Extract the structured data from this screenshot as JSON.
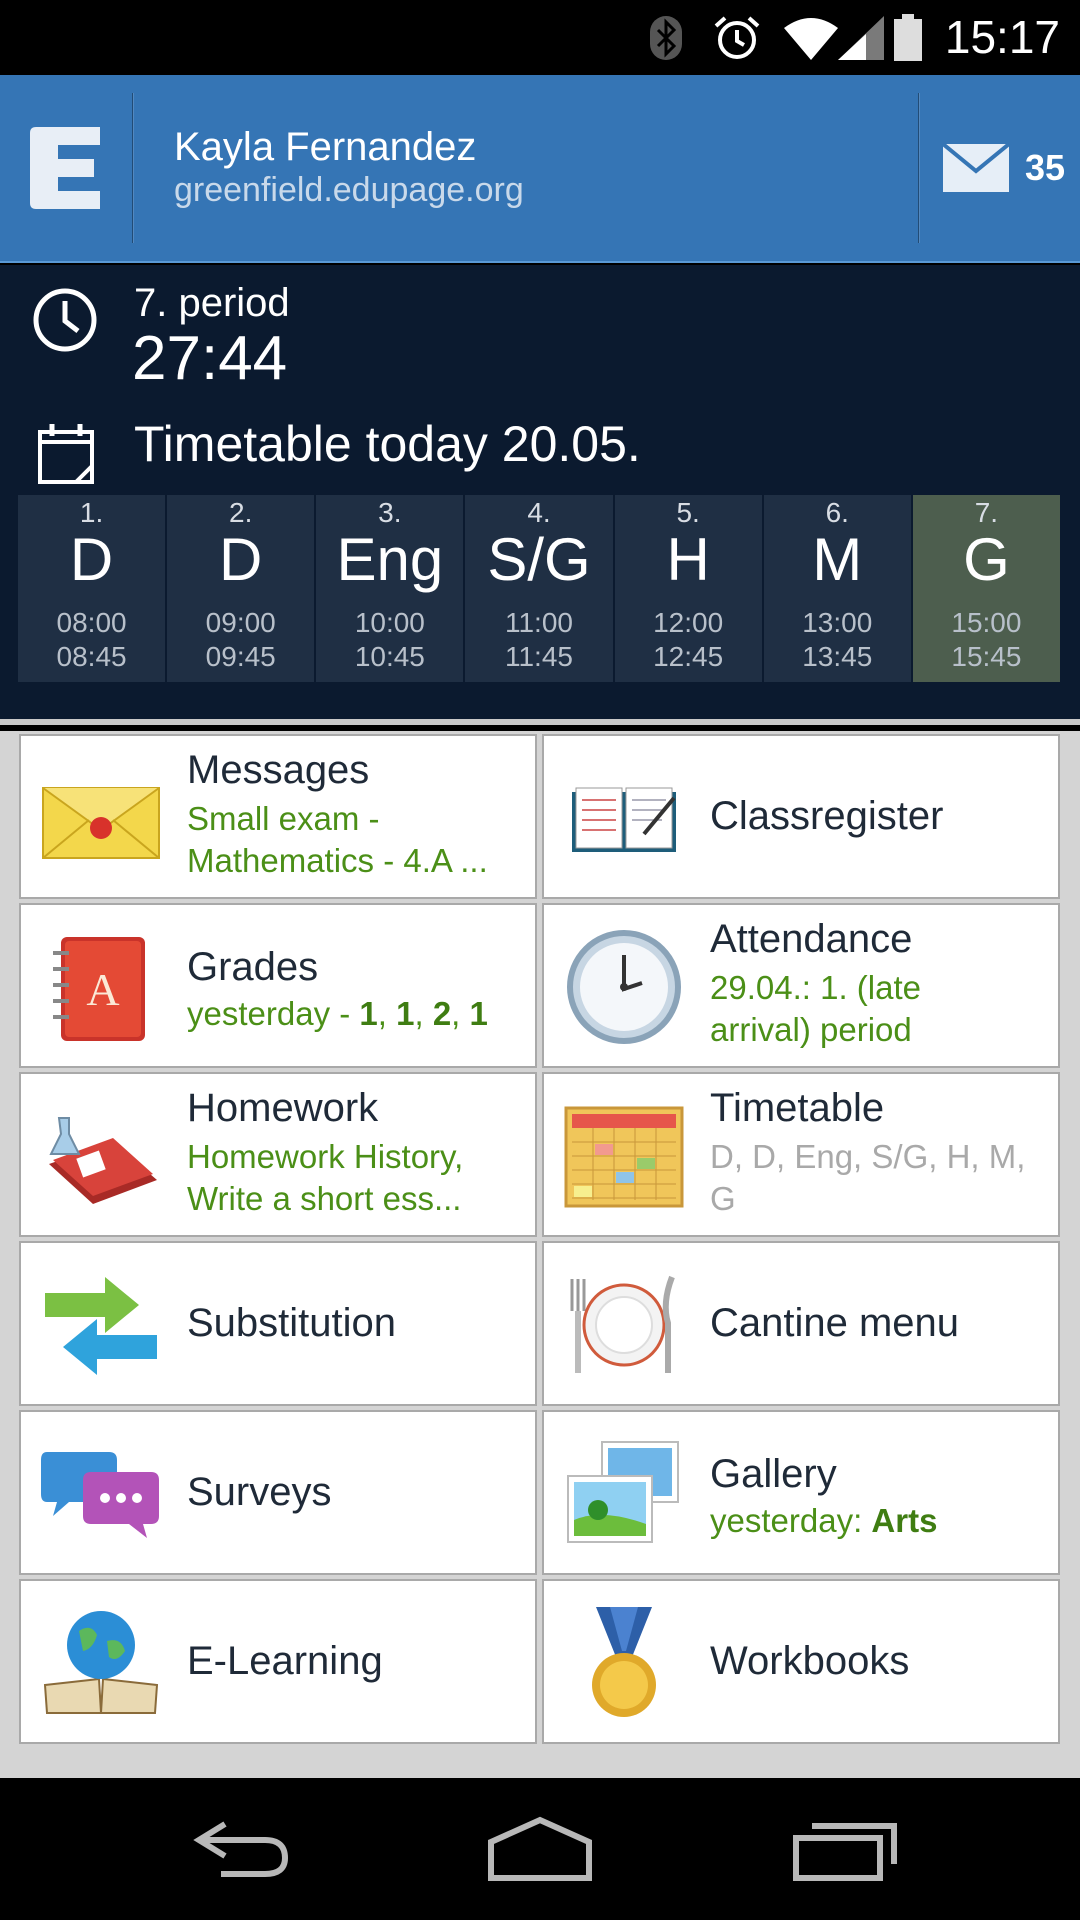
{
  "status_bar": {
    "time": "15:17"
  },
  "header": {
    "logo_letter": "E",
    "user_name": "Kayla Fernandez",
    "domain": "greenfield.edupage.org",
    "mail_count": "35"
  },
  "period": {
    "label": "7. period",
    "countdown": "27:44",
    "timetable_title": "Timetable today 20.05."
  },
  "timetable": [
    {
      "num": "1.",
      "subject": "D",
      "start": "08:00",
      "end": "08:45"
    },
    {
      "num": "2.",
      "subject": "D",
      "start": "09:00",
      "end": "09:45"
    },
    {
      "num": "3.",
      "subject": "Eng",
      "start": "10:00",
      "end": "10:45"
    },
    {
      "num": "4.",
      "subject": "S/G",
      "start": "11:00",
      "end": "11:45"
    },
    {
      "num": "5.",
      "subject": "H",
      "start": "12:00",
      "end": "12:45"
    },
    {
      "num": "6.",
      "subject": "M",
      "start": "13:00",
      "end": "13:45"
    },
    {
      "num": "7.",
      "subject": "G",
      "start": "15:00",
      "end": "15:45",
      "current": true
    }
  ],
  "tiles": {
    "messages": {
      "title": "Messages",
      "line1": "Small exam  -",
      "line2": "Mathematics - 4.A ..."
    },
    "classregister": {
      "title": "Classregister"
    },
    "grades": {
      "title": "Grades",
      "prefix": "yesterday - ",
      "g1": "1",
      "g2": "1",
      "g3": "2",
      "g4": "1",
      "sep": ", "
    },
    "attendance": {
      "title": "Attendance",
      "line1": "29.04.: 1. (late",
      "line2": "arrival) period"
    },
    "homework": {
      "title": "Homework",
      "line1": "Homework History,",
      "line2": "Write a short ess..."
    },
    "timetable": {
      "title": "Timetable",
      "line1": "D, D, Eng, S/G, H, M,",
      "line2": "G"
    },
    "substitution": {
      "title": "Substitution"
    },
    "cantine": {
      "title": "Cantine menu"
    },
    "surveys": {
      "title": "Surveys"
    },
    "gallery": {
      "title": "Gallery",
      "prefix": "yesterday: ",
      "highlight": "Arts"
    },
    "elearning": {
      "title": "E-Learning"
    },
    "workbooks": {
      "title": "Workbooks"
    }
  },
  "icons": {
    "bluetooth": "bluetooth-icon",
    "alarm": "alarm-icon",
    "wifi": "wifi-icon",
    "signal": "signal-icon",
    "battery": "battery-icon",
    "mail": "mail-icon",
    "clock": "clock-icon",
    "calendar": "calendar-icon",
    "back": "back-icon",
    "home": "home-icon",
    "recents": "recents-icon"
  },
  "colors": {
    "header_blue": "#3575b5",
    "panel_dark": "#0b1a2f",
    "cell": "#1f2f44",
    "current_cell": "#4d5e4e",
    "green_text": "#4b8f17"
  }
}
